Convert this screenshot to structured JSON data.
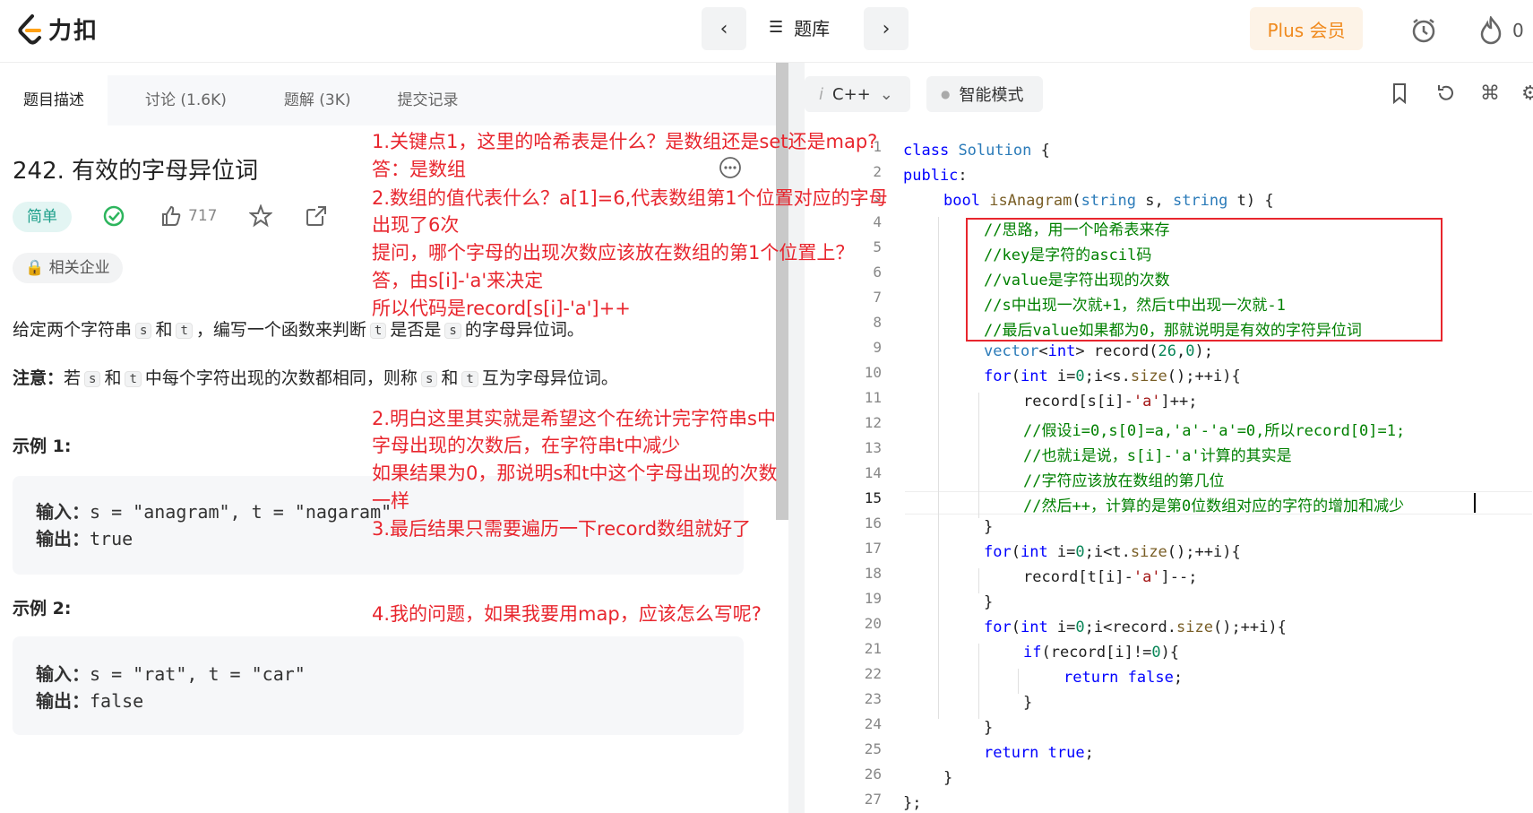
{
  "topbar": {
    "logo_text": "力扣",
    "prev_icon": "chevron-left-icon",
    "next_icon": "chevron-right-icon",
    "menu_icon": "list-icon",
    "tiku_label": "题库",
    "plus_label": "Plus 会员",
    "alarm_icon": "alarm-clock-icon",
    "fire_icon": "flame-icon",
    "fire_count": "0"
  },
  "left": {
    "tabs": [
      {
        "label": "题目描述"
      },
      {
        "label": "讨论 (1.6K)"
      },
      {
        "label": "题解 (3K)"
      },
      {
        "label": "提交记录"
      }
    ],
    "problem_title": "242. 有效的字母异位词",
    "difficulty": "简单",
    "likes": "717",
    "company_label": "相关企业",
    "desc": {
      "p1_a": "给定两个字符串",
      "p1_s": "s",
      "p1_b": "和",
      "p1_t": "t",
      "p1_c": "，编写一个函数来判断",
      "p1_t2": "t",
      "p1_d": "是否是",
      "p1_s2": "s",
      "p1_e": "的字母异位词。",
      "note_label": "注意：",
      "p2_a": "若",
      "p2_s": "s",
      "p2_b": "和",
      "p2_t": "t",
      "p2_c": "中每个字符出现的次数都相同，则称",
      "p2_s2": "s",
      "p2_d": "和",
      "p2_t2": "t",
      "p2_e": "互为字母异位词。"
    },
    "examples": [
      {
        "title": "示例 1:",
        "input_label": "输入：",
        "input": "s = \"anagram\", t = \"nagaram\"",
        "output_label": "输出：",
        "output": "true"
      },
      {
        "title": "示例 2:",
        "input_label": "输入：",
        "input": "s = \"rat\", t = \"car\"",
        "output_label": "输出：",
        "output": "false"
      }
    ]
  },
  "annotations": [
    "1.关键点1，这里的哈希表是什么？是数组还是set还是map?",
    "答：是数组",
    "2.数组的值代表什么？a[1]=6,代表数组第1个位置对应的字母",
    "出现了6次",
    "提问，哪个字母的出现次数应该放在数组的第1个位置上？",
    "答，由s[i]-'a'来决定",
    "所以代码是record[s[i]-'a']++",
    "2.明白这里其实就是希望这个在统计完字符串s中",
    "字母出现的次数后，在字符串t中减少",
    "如果结果为0，那说明s和t中这个字母出现的次数",
    "一样",
    "3.最后结果只需要遍历一下record数组就好了",
    "4.我的问题，如果我要用map，应该怎么写呢?"
  ],
  "editor": {
    "language": "C++",
    "language_prefix": "i",
    "mode_label": "智能模式",
    "current_line": 15,
    "line_numbers": [
      "1",
      "2",
      "3",
      "4",
      "5",
      "6",
      "7",
      "8",
      "9",
      "10",
      "11",
      "12",
      "13",
      "14",
      "15",
      "16",
      "17",
      "18",
      "19",
      "20",
      "21",
      "22",
      "23",
      "24",
      "25",
      "26",
      "27"
    ]
  }
}
